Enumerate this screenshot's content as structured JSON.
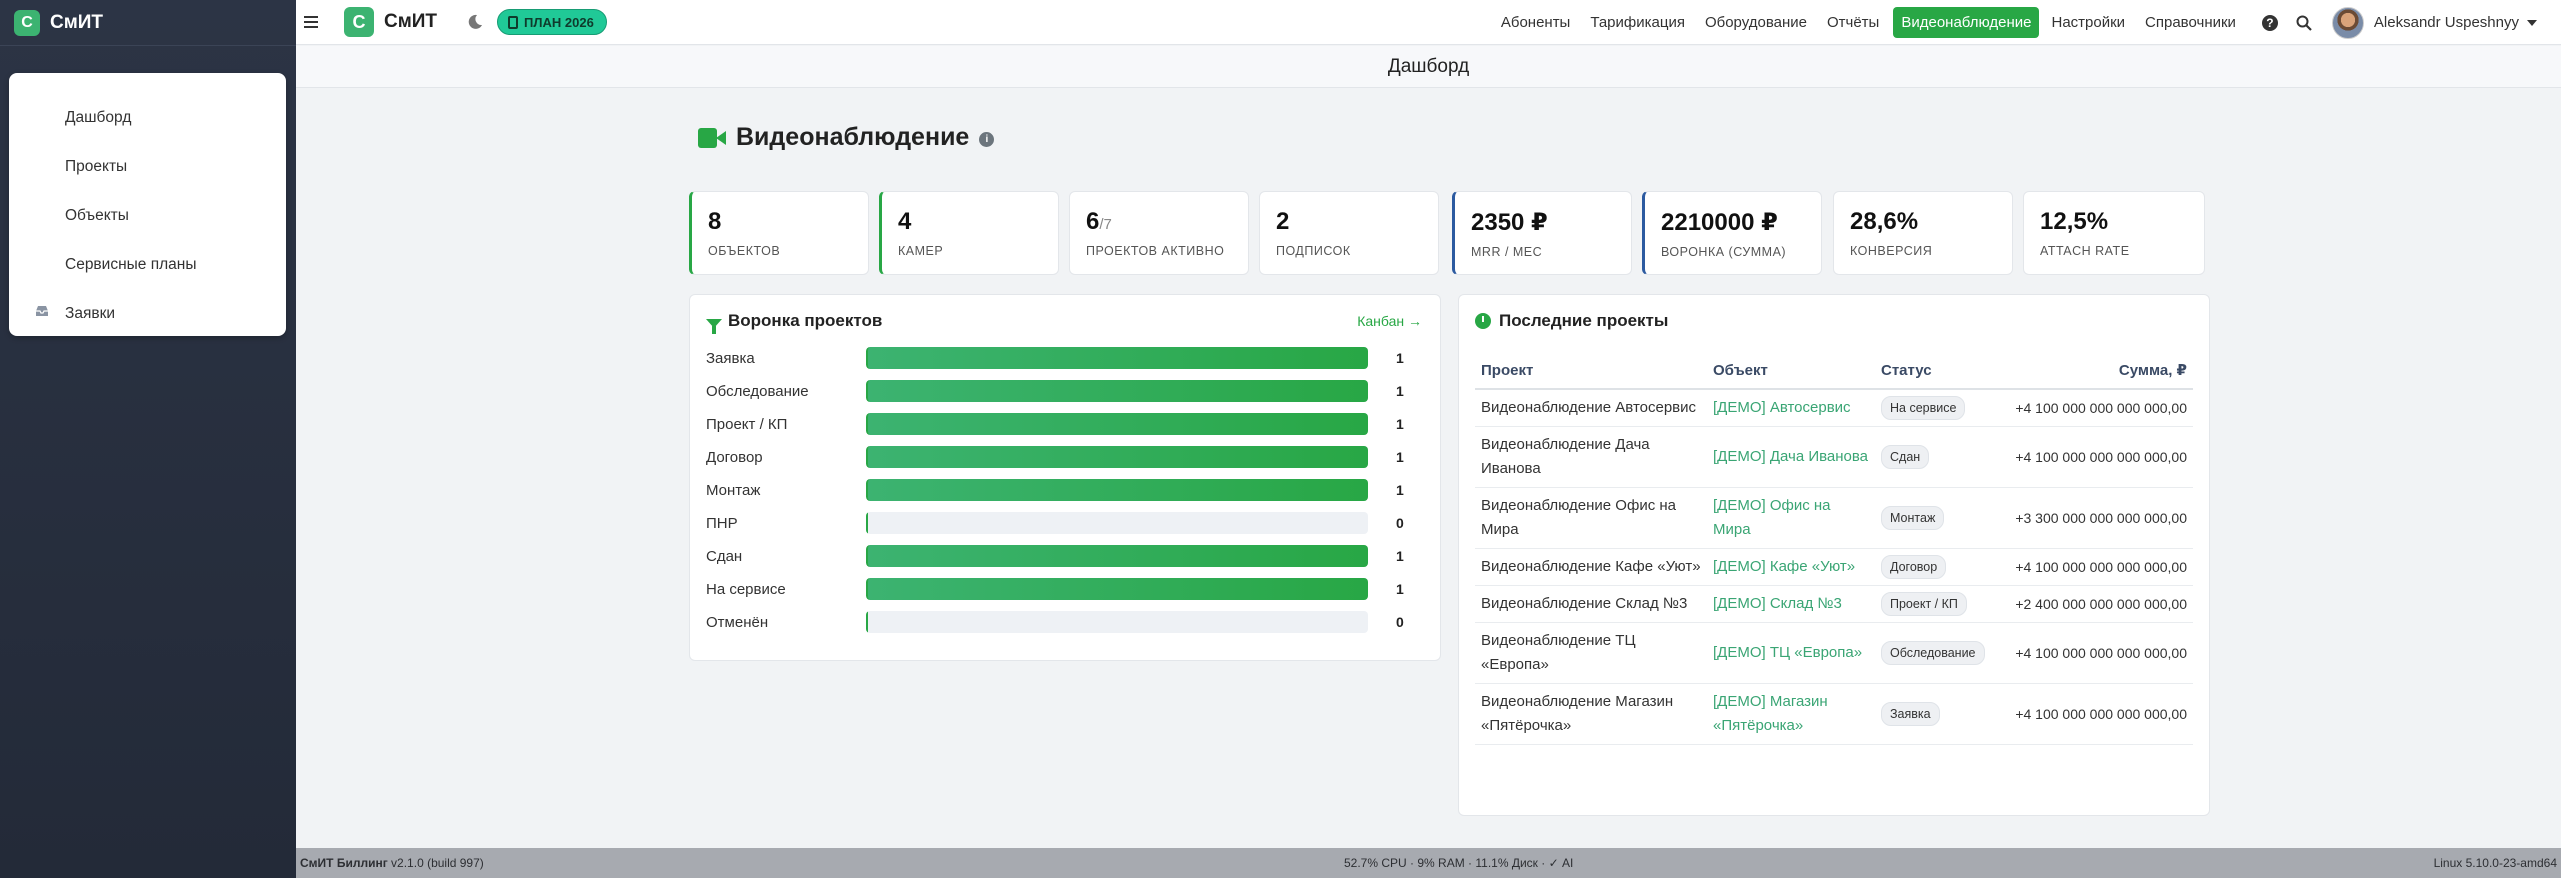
{
  "sidebar": {
    "brand": "СмИТ",
    "brand_initial": "С",
    "items": [
      {
        "label": "Дашборд"
      },
      {
        "label": "Проекты"
      },
      {
        "label": "Объекты"
      },
      {
        "label": "Сервисные планы"
      },
      {
        "label": "Заявки",
        "icon": "inbox-icon"
      }
    ]
  },
  "header": {
    "brand": "СмИТ",
    "brand_initial": "С",
    "plan_badge": "ПЛАН 2026",
    "nav": [
      "Абоненты",
      "Тарификация",
      "Оборудование",
      "Отчёты",
      "Видеонаблюдение",
      "Настройки",
      "Справочники"
    ],
    "active_nav": "Видеонаблюдение",
    "help_glyph": "?",
    "user_name": "Aleksandr Uspeshnyy"
  },
  "page": {
    "title": "Дашборд",
    "section_title": "Видеонаблюдение",
    "info_glyph": "i"
  },
  "stats": [
    {
      "value": "8",
      "label": "ОБЪЕКТОВ"
    },
    {
      "value": "4",
      "label": "КАМЕР"
    },
    {
      "value": "6",
      "sub": "/7",
      "label": "ПРОЕКТОВ АКТИВНО"
    },
    {
      "value": "2",
      "label": "ПОДПИСОК"
    },
    {
      "value": "2350 ₽",
      "label": "MRR / МЕС"
    },
    {
      "value": "2210000 ₽",
      "label": "ВОРОНКА (СУММА)"
    },
    {
      "value": "28,6%",
      "label": "КОНВЕРСИЯ"
    },
    {
      "value": "12,5%",
      "label": "ATTACH RATE"
    }
  ],
  "funnel": {
    "title": "Воронка проектов",
    "link": "Канбан →",
    "stages": [
      {
        "label": "Заявка",
        "count": 1
      },
      {
        "label": "Обследование",
        "count": 1
      },
      {
        "label": "Проект / КП",
        "count": 1
      },
      {
        "label": "Договор",
        "count": 1
      },
      {
        "label": "Монтаж",
        "count": 1
      },
      {
        "label": "ПНР",
        "count": 0
      },
      {
        "label": "Сдан",
        "count": 1
      },
      {
        "label": "На сервисе",
        "count": 1
      },
      {
        "label": "Отменён",
        "count": 0
      }
    ]
  },
  "recent": {
    "title": "Последние проекты",
    "columns": [
      "Проект",
      "Объект",
      "Статус",
      "Сумма, ₽"
    ],
    "rows": [
      {
        "project": "Видеонаблюдение Автосервис",
        "object": "[ДЕМО] Автосервис",
        "status": "На сервисе",
        "sum": "+4 100 000 000 000 000,00"
      },
      {
        "project": "Видеонаблюдение Дача Иванова",
        "object": "[ДЕМО] Дача Иванова",
        "status": "Сдан",
        "sum": "+4 100 000 000 000 000,00"
      },
      {
        "project": "Видеонаблюдение Офис на Мира",
        "object": "[ДЕМО] Офис на Мира",
        "status": "Монтаж",
        "sum": "+3 300 000 000 000 000,00"
      },
      {
        "project": "Видеонаблюдение Кафе «Уют»",
        "object": "[ДЕМО] Кафе «Уют»",
        "status": "Договор",
        "sum": "+4 100 000 000 000 000,00"
      },
      {
        "project": "Видеонаблюдение Склад №3",
        "object": "[ДЕМО] Склад №3",
        "status": "Проект / КП",
        "sum": "+2 400 000 000 000 000,00"
      },
      {
        "project": "Видеонаблюдение ТЦ «Европа»",
        "object": "[ДЕМО] ТЦ «Европа»",
        "status": "Обследование",
        "sum": "+4 100 000 000 000 000,00"
      },
      {
        "project": "Видеонаблюдение Магазин «Пятёрочка»",
        "object": "[ДЕМО] Магазин «Пятёрочка»",
        "status": "Заявка",
        "sum": "+4 100 000 000 000 000,00"
      }
    ]
  },
  "footer": {
    "app": "СмИТ Биллинг",
    "version": "v2.1.0 (build 997)",
    "metrics": "52.7% CPU · 9% RAM · 11.1% Диск · ✓ AI",
    "os": "Linux 5.10.0-23-amd64"
  },
  "colors": {
    "accent": "#28a745",
    "sidebar_bg": "#2c3445",
    "badge": "#20c997",
    "kpi_blue": "#2c5aa0"
  }
}
